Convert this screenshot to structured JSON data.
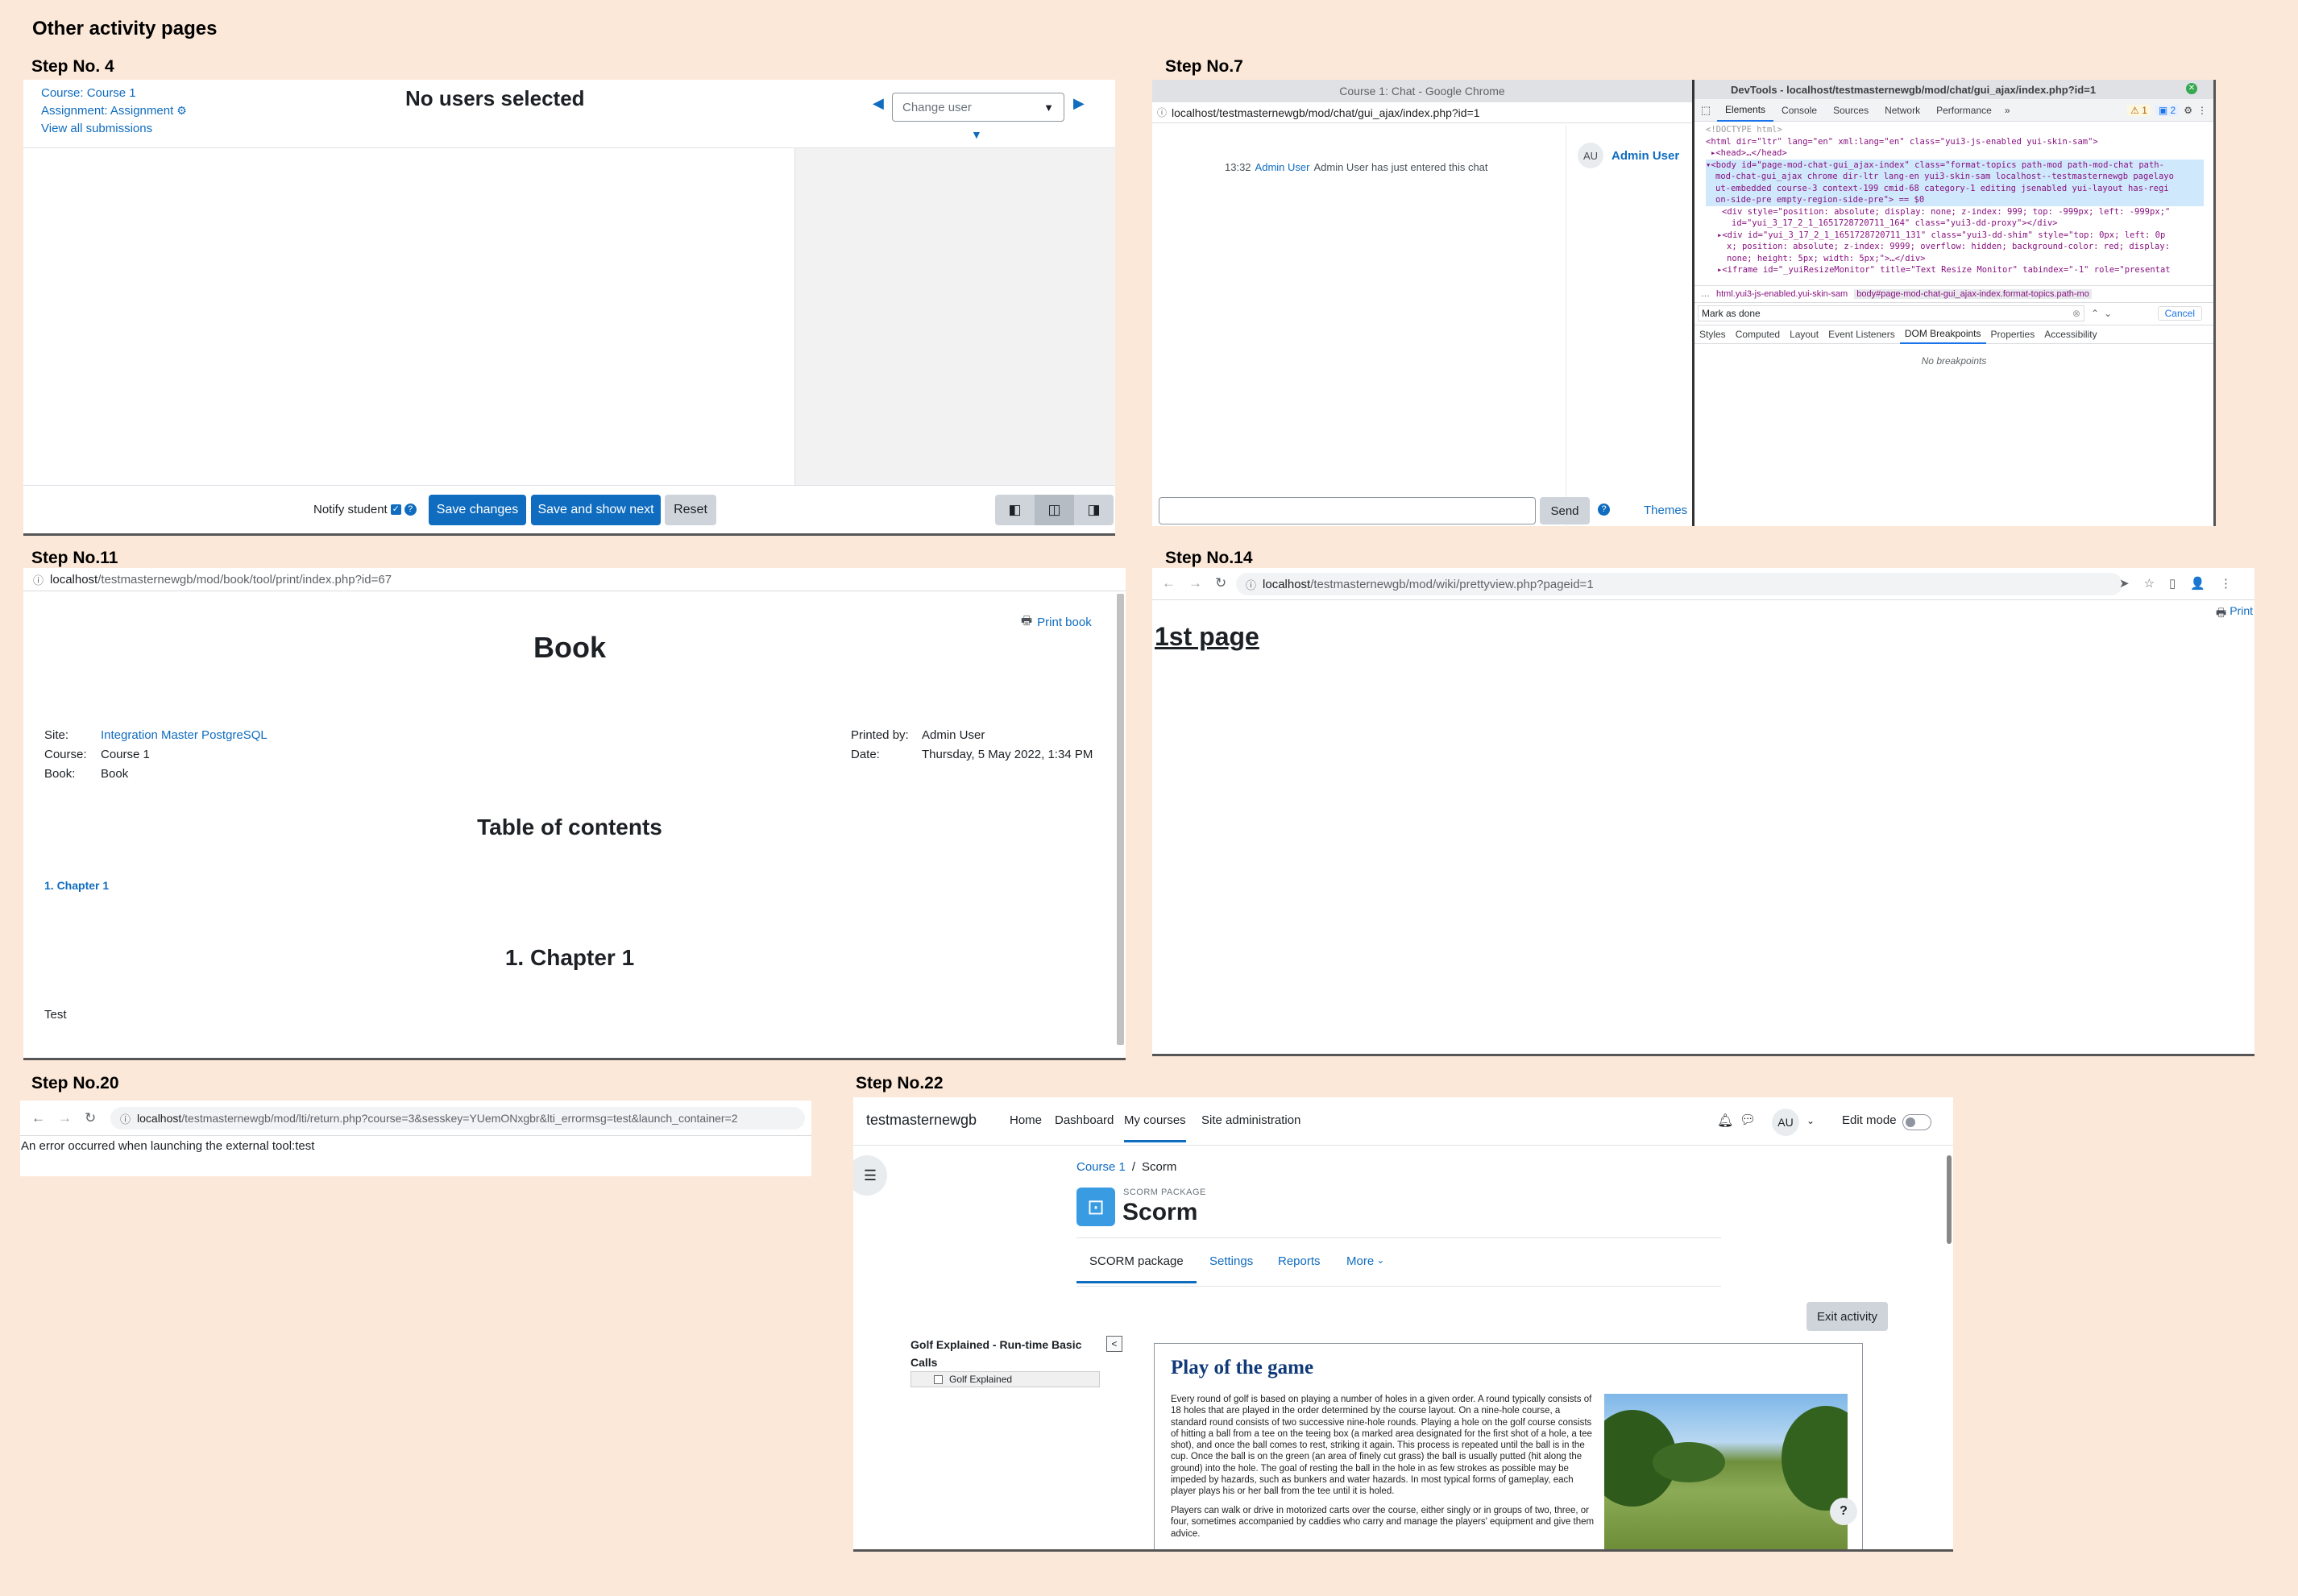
{
  "page_title": "Other activity pages",
  "steps": {
    "s4": {
      "label": "Step No. 4",
      "course_link": "Course: Course 1",
      "assignment_link": "Assignment: Assignment",
      "view_all": "View all submissions",
      "heading": "No users selected",
      "change_user_placeholder": "Change user",
      "notify_label": "Notify student",
      "save_changes": "Save changes",
      "save_next": "Save and show next",
      "reset": "Reset"
    },
    "s7": {
      "label": "Step No.7",
      "chrome_title": "Course 1: Chat - Google Chrome",
      "url": "localhost/testmasternewgb/mod/chat/gui_ajax/index.php?id=1",
      "msg_time": "13:32",
      "msg_user": "Admin User",
      "msg_text": "Admin User has just entered this chat",
      "avatar": "AU",
      "user_name": "Admin User",
      "send": "Send",
      "themes": "Themes",
      "devtools_title": "DevTools - localhost/testmasternewgb/mod/chat/gui_ajax/index.php?id=1",
      "dt_tabs": [
        "Elements",
        "Console",
        "Sources",
        "Network",
        "Performance",
        "»"
      ],
      "dt_warn": "1",
      "dt_msg": "2",
      "dom_lines": [
        "<!DOCTYPE html>",
        "<html dir=\"ltr\" lang=\"en\" xml:lang=\"en\" class=\"yui3-js-enabled yui-skin-sam\">",
        "▸<head>…</head>",
        "▾<body id=\"page-mod-chat-gui_ajax-index\" class=\"format-topics  path-mod path-mod-chat path-",
        "mod-chat-gui_ajax chrome dir-ltr lang-en yui3-skin-sam localhost--testmasternewgb pagelayo",
        "ut-embedded course-3 context-199 cmid-68 category-1 editing  jsenabled yui-layout has-regi",
        "on-side-pre empty-region-side-pre\"> == $0",
        "<div style=\"position: absolute; display: none; z-index: 999; top: -999px; left: -999px;\"",
        "id=\"yui_3_17_2_1_1651728720711_164\" class=\"yui3-dd-proxy\"></div>",
        "▸<div id=\"yui_3_17_2_1_1651728720711_131\" class=\"yui3-dd-shim\" style=\"top: 0px; left: 0p",
        "x; position: absolute; z-index: 9999; overflow: hidden; background-color: red; display:",
        "none; height: 5px; width: 5px;\">…</div>",
        "▸<iframe id=\"_yuiResizeMonitor\" title=\"Text Resize Monitor\" tabindex=\"-1\" role=\"presentat"
      ],
      "breadcrumb_a": "html.yui3-js-enabled.yui-skin-sam",
      "breadcrumb_b": "body#page-mod-chat-gui_ajax-index.format-topics.path-mo",
      "search_value": "Mark as done",
      "search_cancel": "Cancel",
      "sub_tabs": [
        "Styles",
        "Computed",
        "Layout",
        "Event Listeners",
        "DOM Breakpoints",
        "Properties",
        "Accessibility"
      ],
      "no_breakpoints": "No breakpoints"
    },
    "s11": {
      "label": "Step No.11",
      "url_host": "localhost",
      "url_path": "/testmasternewgb/mod/book/tool/print/index.php?id=67",
      "print_book": "Print book",
      "title": "Book",
      "site_label": "Site:",
      "site_value": "Integration Master PostgreSQL",
      "course_label": "Course:",
      "course_value": "Course 1",
      "book_label": "Book:",
      "book_value": "Book",
      "printed_label": "Printed by:",
      "printed_value": "Admin User",
      "date_label": "Date:",
      "date_value": "Thursday, 5 May 2022, 1:34 PM",
      "toc": "Table of contents",
      "toc_item": "1. Chapter 1",
      "chapter": "1. Chapter 1",
      "body": "Test"
    },
    "s14": {
      "label": "Step No.14",
      "url_host": "localhost",
      "url_path": "/testmasternewgb/mod/wiki/prettyview.php?pageid=1",
      "print": "Print",
      "title": "1st page"
    },
    "s20": {
      "label": "Step No.20",
      "url_host": "localhost",
      "url_path": "/testmasternewgb/mod/lti/return.php?course=3&sesskey=YUemONxgbr&lti_errormsg=test&launch_container=2",
      "error": "An error occurred when launching the external tool:test"
    },
    "s22": {
      "label": "Step No.22",
      "brand": "testmasternewgb",
      "nav": [
        "Home",
        "Dashboard",
        "My courses",
        "Site administration"
      ],
      "avatar": "AU",
      "edit_mode": "Edit mode",
      "crumb_course": "Course 1",
      "crumb_sep": "/",
      "crumb_current": "Scorm",
      "pkg_label": "SCORM PACKAGE",
      "title": "Scorm",
      "tabs": [
        "SCORM package",
        "Settings",
        "Reports",
        "More"
      ],
      "exit": "Exit activity",
      "toc_title": "Golf Explained - Run-time Basic Calls",
      "toc_item": "Golf Explained",
      "toc_toggle": "<",
      "content_title": "Play of the game",
      "para1": "Every round of golf is based on playing a number of holes in a given order. A round typically consists of 18 holes that are played in the order determined by the course layout. On a nine-hole course, a standard round consists of two successive nine-hole rounds. Playing a hole on the golf course consists of hitting a ball from a tee on the teeing box (a marked area designated for the first shot of a hole, a tee shot), and once the ball comes to rest, striking it again. This process is repeated until the ball is in the cup. Once the ball is on the green (an area of finely cut grass) the ball is usually putted (hit along the ground) into the hole. The goal of resting the ball in the hole in as few strokes as possible may be impeded by hazards, such as bunkers and water hazards. In most typical forms of gameplay, each player plays his or her ball from the tee until it is holed.",
      "para2": "Players can walk or drive in motorized carts over the course, either singly or in groups of two, three, or four, sometimes accompanied by caddies who carry and manage the players' equipment and give them advice.",
      "help": "?"
    }
  }
}
